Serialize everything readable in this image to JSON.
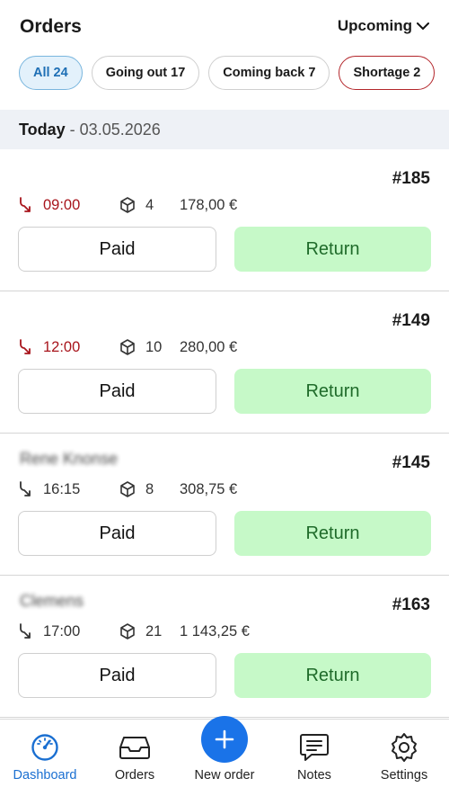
{
  "header": {
    "title": "Orders",
    "range": "Upcoming"
  },
  "filters": [
    {
      "label": "All 24",
      "state": "active"
    },
    {
      "label": "Going out 17",
      "state": "default"
    },
    {
      "label": "Coming back 7",
      "state": "default"
    },
    {
      "label": "Shortage 2",
      "state": "warning"
    }
  ],
  "day": {
    "label": "Today",
    "separator": "-",
    "date": "03.05.2026"
  },
  "orders": [
    {
      "customer": "",
      "number": "#185",
      "time": "09:00",
      "late": true,
      "items": "4",
      "amount": "178,00 €",
      "paid_label": "Paid",
      "return_label": "Return"
    },
    {
      "customer": "",
      "number": "#149",
      "time": "12:00",
      "late": true,
      "items": "10",
      "amount": "280,00 €",
      "paid_label": "Paid",
      "return_label": "Return"
    },
    {
      "customer": "Rene Knonse",
      "number": "#145",
      "time": "16:15",
      "late": false,
      "items": "8",
      "amount": "308,75 €",
      "paid_label": "Paid",
      "return_label": "Return"
    },
    {
      "customer": "Clemens",
      "number": "#163",
      "time": "17:00",
      "late": false,
      "items": "21",
      "amount": "1 143,25 €",
      "paid_label": "Paid",
      "return_label": "Return"
    }
  ],
  "tabbar": [
    {
      "label": "Dashboard",
      "icon": "gauge-icon",
      "active": true
    },
    {
      "label": "Orders",
      "icon": "inbox-icon",
      "active": false
    },
    {
      "label": "New order",
      "icon": "plus-icon",
      "active": false
    },
    {
      "label": "Notes",
      "icon": "chat-icon",
      "active": false
    },
    {
      "label": "Settings",
      "icon": "gear-icon",
      "active": false
    }
  ],
  "colors": {
    "accent": "#1a73e8",
    "late": "#a8151c",
    "return_bg": "#c6f9c8",
    "return_text": "#1f6b2a",
    "day_header_bg": "#eef1f6"
  }
}
